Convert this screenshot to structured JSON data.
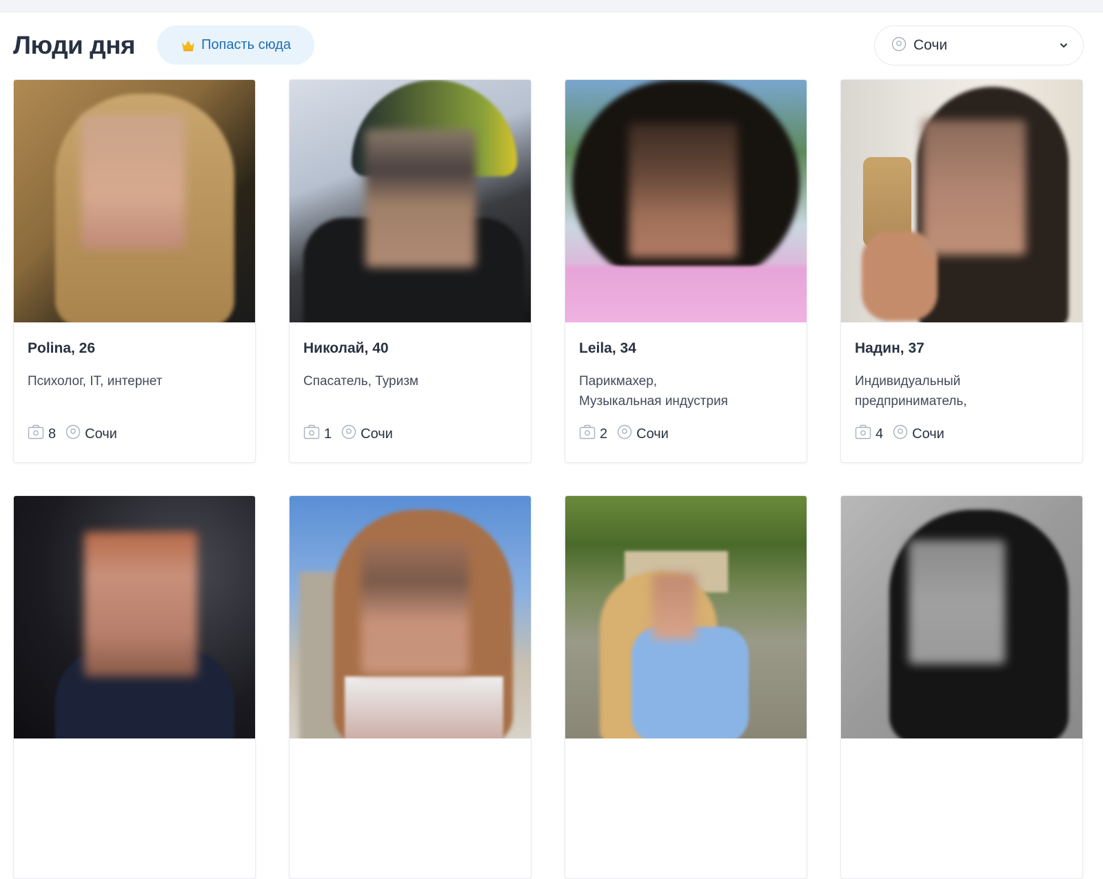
{
  "header": {
    "title": "Люди дня",
    "promo_label": "Попасть сюда",
    "city_select": {
      "value": "Сочи"
    }
  },
  "colors": {
    "accent": "#1d6fb6",
    "promo_bg": "#e8f3fc",
    "crown": "#f5b81c",
    "text": "#283142"
  },
  "profiles": [
    {
      "name": "Polina, 26",
      "profession": "Психолог, IT, интернет",
      "photos": "8",
      "city": "Сочи"
    },
    {
      "name": "Николай, 40",
      "profession": "Спасатель, Туризм",
      "photos": "1",
      "city": "Сочи"
    },
    {
      "name": "Leila, 34",
      "profession": "Парикмахер,\nМузыкальная индустрия",
      "photos": "2",
      "city": "Сочи"
    },
    {
      "name": "Надин, 37",
      "profession": "Индивидуальный предприниматель,\nОбразование",
      "photos": "4",
      "city": "Сочи"
    },
    {
      "name": "",
      "profession": "",
      "photos": "",
      "city": ""
    },
    {
      "name": "",
      "profession": "",
      "photos": "",
      "city": ""
    },
    {
      "name": "",
      "profession": "",
      "photos": "",
      "city": ""
    },
    {
      "name": "",
      "profession": "",
      "photos": "",
      "city": ""
    }
  ],
  "icons": {
    "crown": "crown-icon",
    "location": "location-pin-icon",
    "camera": "camera-icon",
    "chevron": "chevron-down-icon"
  }
}
